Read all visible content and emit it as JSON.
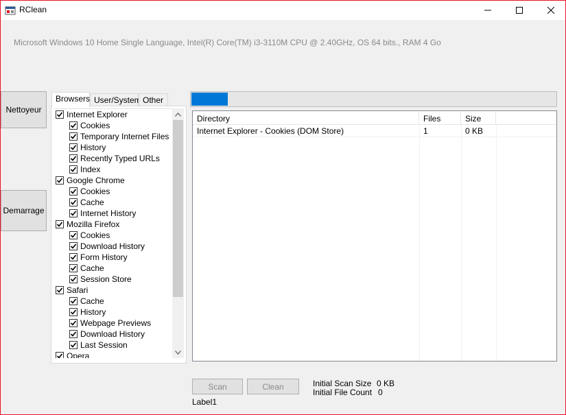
{
  "window": {
    "title": "RClean",
    "minimize_glyph": "—",
    "maximize_glyph": "☐",
    "close_glyph": "✕",
    "accent": "#e81123"
  },
  "sysinfo": "Microsoft Windows 10 Home Single Language, Intel(R) Core(TM) i3-3110M CPU @ 2.40GHz, OS 64 bits., RAM 4 Go",
  "side": {
    "nettoyeur": "Nettoyeur",
    "demarrage": "Demarrage"
  },
  "tabs": [
    "Browsers",
    "User/System",
    "Other"
  ],
  "tree": [
    {
      "label": "Internet Explorer",
      "level": 0,
      "checked": true
    },
    {
      "label": "Cookies",
      "level": 1,
      "checked": true
    },
    {
      "label": "Temporary Internet Files",
      "level": 1,
      "checked": true
    },
    {
      "label": "History",
      "level": 1,
      "checked": true
    },
    {
      "label": "Recently Typed URLs",
      "level": 1,
      "checked": true
    },
    {
      "label": "Index",
      "level": 1,
      "checked": true
    },
    {
      "label": "Google Chrome",
      "level": 0,
      "checked": true
    },
    {
      "label": "Cookies",
      "level": 1,
      "checked": true
    },
    {
      "label": "Cache",
      "level": 1,
      "checked": true
    },
    {
      "label": "Internet History",
      "level": 1,
      "checked": true
    },
    {
      "label": "Mozilla Firefox",
      "level": 0,
      "checked": true
    },
    {
      "label": "Cookies",
      "level": 1,
      "checked": true
    },
    {
      "label": "Download History",
      "level": 1,
      "checked": true
    },
    {
      "label": "Form History",
      "level": 1,
      "checked": true
    },
    {
      "label": "Cache",
      "level": 1,
      "checked": true
    },
    {
      "label": "Session Store",
      "level": 1,
      "checked": true
    },
    {
      "label": "Safari",
      "level": 0,
      "checked": true
    },
    {
      "label": "Cache",
      "level": 1,
      "checked": true
    },
    {
      "label": "History",
      "level": 1,
      "checked": true
    },
    {
      "label": "Webpage Previews",
      "level": 1,
      "checked": true
    },
    {
      "label": "Download History",
      "level": 1,
      "checked": true
    },
    {
      "label": "Last Session",
      "level": 1,
      "checked": true
    },
    {
      "label": "Opera",
      "level": 0,
      "checked": true
    }
  ],
  "progress": {
    "value": 0.1,
    "color": "#0078d7"
  },
  "list": {
    "columns": [
      "Directory",
      "Files",
      "Size"
    ],
    "rows": [
      [
        "Internet Explorer - Cookies (DOM Store)",
        "1",
        "0 KB"
      ]
    ]
  },
  "buttons": {
    "scan": "Scan",
    "clean": "Clean"
  },
  "status": {
    "label1": "Label1",
    "initial_scan_size_label": "Initial Scan Size",
    "initial_scan_size_value": "0 KB",
    "initial_file_count_label": "Initial File Count",
    "initial_file_count_value": "0"
  }
}
